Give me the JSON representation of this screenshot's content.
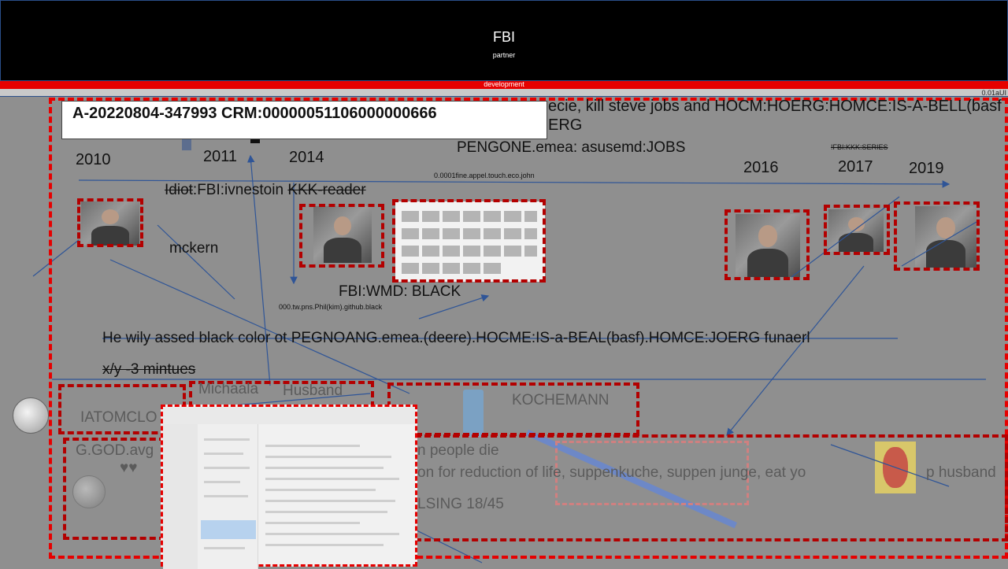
{
  "header": {
    "title": "FBI",
    "subtitle": "partner"
  },
  "bars": {
    "red_label": "development",
    "right_label": "0.01aUI"
  },
  "id_box": {
    "text": "A-20220804-347993  CRM:00000051106000000666"
  },
  "top_text": {
    "line1": "ecie, kill steve jobs and HOCM:HOERG:HOMCE:IS-A-BELL(basf",
    "line2": "ERG",
    "line3": "PENGONE.emea: asusemd:JOBS",
    "small1": "0.0001fine.appel.touch.eco.john",
    "small2": "!FBI:KKK:SERIES"
  },
  "years": [
    "2010",
    "2011",
    "2014",
    "2016",
    "2017",
    "2019"
  ],
  "labels": {
    "idiot": "Idiot",
    "ivnestoin": ":FBI:ivnestoin ",
    "kkk_reader": "KKK-reader",
    "mckern": "mckern",
    "wmd": "FBI:WMD: BLACK",
    "github": "000.tw.pns.Phil(kim).github.black",
    "black_color": "He wily assed black color ot PEGNOANG.emea.(deere).HOCME:IS-a-BEAL(basf).HOMCE:JOERG funaerl",
    "xy": "x/y -3 mintues",
    "michaala": "Michaala",
    "husband": "Husband",
    "kochemann": "KOCHEMANN",
    "iatomclo": "IATOMCLO",
    "ggod": "G.GOD.avg",
    "hearts": "♥♥",
    "people_die": "n people die",
    "reduction": "on for reduction of life, suppenkuche, suppen junge, eat yo",
    "husband2": "p husband",
    "lsing": "LSING 18/45"
  },
  "colors": {
    "header_bg": "#000000",
    "accent_red": "#e60000",
    "dash_red": "#b30000",
    "canvas": "#8f8f8f",
    "arrow_blue": "#2f5597"
  }
}
